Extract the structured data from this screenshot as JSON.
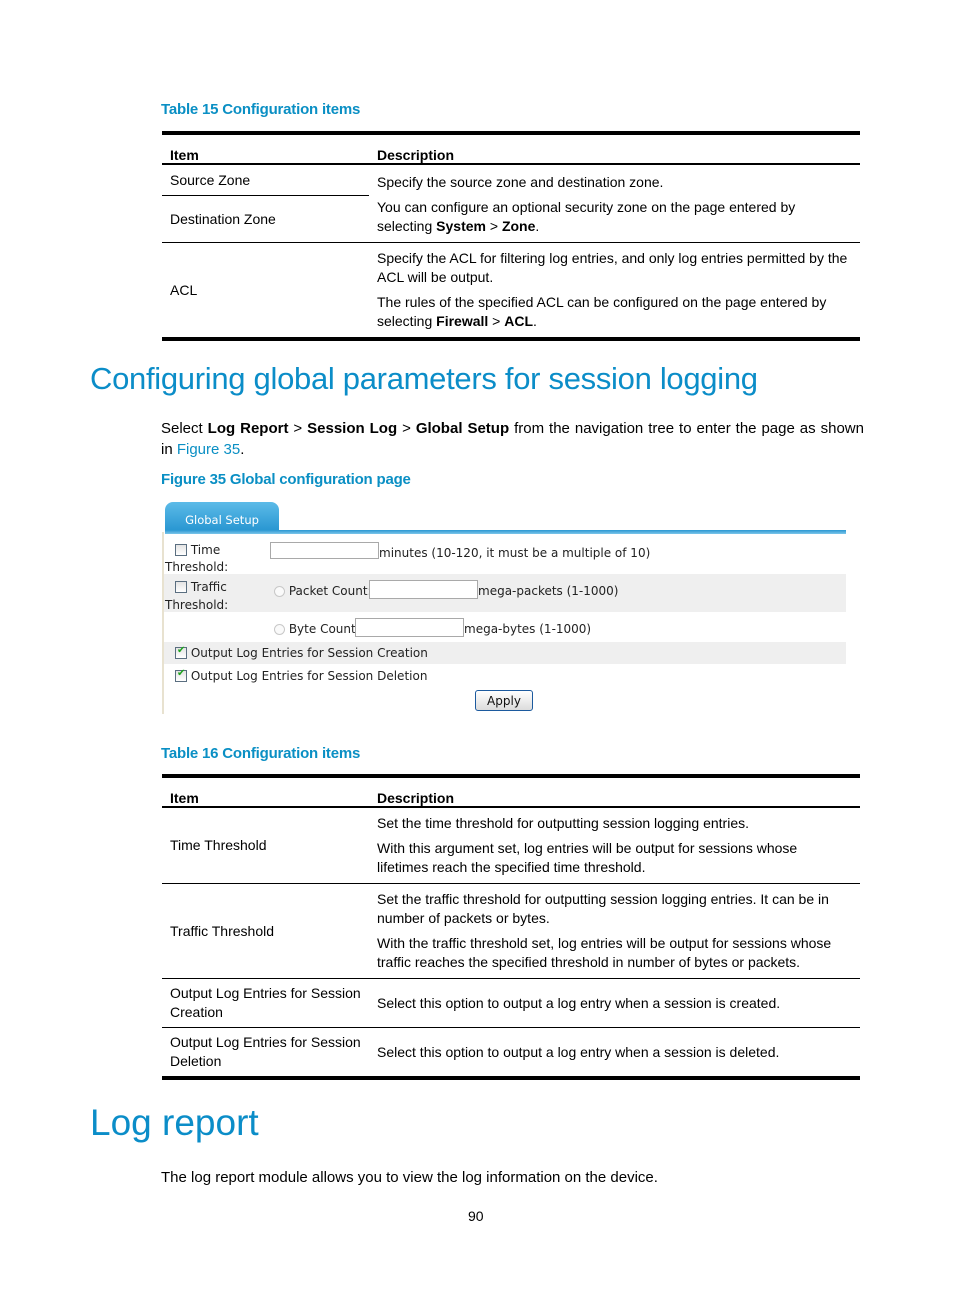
{
  "table15": {
    "caption": "Table 15 Configuration items",
    "headers": [
      "Item",
      "Description"
    ],
    "rows": [
      {
        "item": "Source Zone",
        "desc": [
          "Specify the source zone and destination zone."
        ]
      },
      {
        "item": "Destination Zone",
        "desc_pre": "You can configure an optional security zone on the page entered by selecting ",
        "desc_b1": "System",
        "desc_sep": " > ",
        "desc_b2": "Zone",
        "desc_post": "."
      },
      {
        "item": "ACL",
        "desc": [
          "Specify the ACL for filtering log entries, and only log entries permitted by the ACL will be output."
        ],
        "desc2_pre": "The rules of the specified ACL can be configured on the page entered by selecting ",
        "desc2_b1": "Firewall",
        "desc2_sep": " > ",
        "desc2_b2": "ACL",
        "desc2_post": "."
      }
    ]
  },
  "section1": {
    "heading": "Configuring global parameters for session logging",
    "intro": {
      "select": "Select ",
      "b1": "Log Report",
      "sep1": " > ",
      "b2": "Session Log",
      "sep2": " > ",
      "b3": "Global Setup",
      "rest": " from the navigation tree to enter the page as shown in ",
      "link": "Figure 35",
      "end": "."
    },
    "figure_caption": "Figure 35 Global configuration page"
  },
  "figure": {
    "tab_label": "Global Setup",
    "time_threshold": {
      "label_line1": "Time",
      "label_line2": "Threshold:",
      "checked": false,
      "value": "",
      "hint": "minutes (10-120, it must be a multiple of 10)"
    },
    "traffic_threshold": {
      "label_line1": "Traffic",
      "label_line2": "Threshold:",
      "checked": false
    },
    "packet_count": {
      "label": "Packet Count:",
      "value": "",
      "hint": "mega-packets (1-1000)",
      "selected": false
    },
    "byte_count": {
      "label": "Byte Count:",
      "value": "",
      "hint": "mega-bytes (1-1000)",
      "selected": false
    },
    "output_creation": {
      "label": "Output Log Entries for Session Creation",
      "checked": true
    },
    "output_deletion": {
      "label": "Output Log Entries for Session Deletion",
      "checked": true
    },
    "apply_label": "Apply"
  },
  "table16": {
    "caption": "Table 16 Configuration items",
    "headers": [
      "Item",
      "Description"
    ],
    "rows": [
      {
        "item": "Time Threshold",
        "desc": [
          "Set the time threshold for outputting session logging entries.",
          "With this argument set, log entries will be output for sessions whose lifetimes reach the specified time threshold."
        ]
      },
      {
        "item": "Traffic Threshold",
        "desc": [
          "Set the traffic threshold for outputting session logging entries. It can be in number of packets or bytes.",
          "With the traffic threshold set, log entries will be output for sessions whose traffic reaches the specified threshold in number of bytes or packets."
        ]
      },
      {
        "item": "Output Log Entries for Session Creation",
        "desc": [
          "Select this option to output a log entry when a session is created."
        ]
      },
      {
        "item": "Output Log Entries for Session Deletion",
        "desc": [
          "Select this option to output a log entry when a session is deleted."
        ]
      }
    ]
  },
  "section2": {
    "heading": "Log report",
    "intro": "The log report module allows you to view the log information on the device."
  },
  "page_number": "90"
}
